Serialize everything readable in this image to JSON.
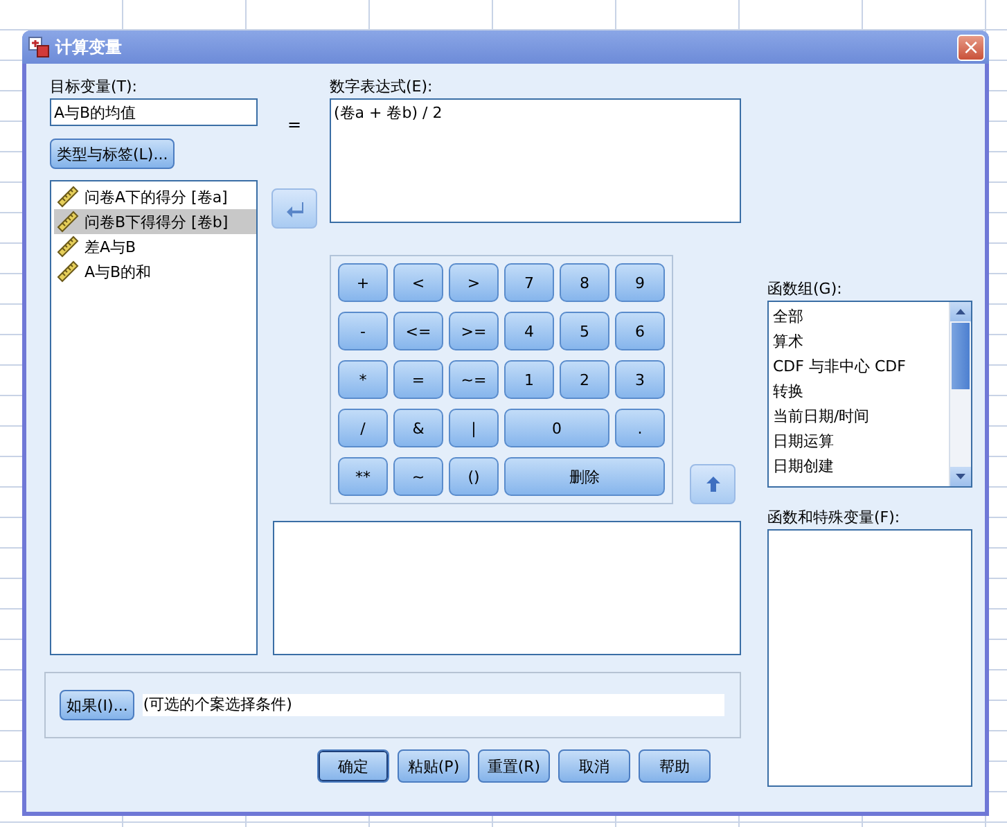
{
  "window": {
    "title": "计算变量",
    "close_label": "×"
  },
  "target": {
    "label": "目标变量(T):",
    "value": "A与B的均值",
    "type_button": "类型与标签(L)..."
  },
  "equals": "=",
  "variables": [
    {
      "name": "问卷A下的得分 [卷a]",
      "selected": false
    },
    {
      "name": "问卷B下得得分 [卷b]",
      "selected": true
    },
    {
      "name": "差A与B",
      "selected": false
    },
    {
      "name": "A与B的和",
      "selected": false
    }
  ],
  "expression": {
    "label": "数字表达式(E):",
    "value": "(卷a + 卷b) / 2"
  },
  "keypad": [
    {
      "label": "+",
      "kind": "key"
    },
    {
      "label": "<",
      "kind": "key"
    },
    {
      "label": ">",
      "kind": "key"
    },
    {
      "label": "7",
      "kind": "key"
    },
    {
      "label": "8",
      "kind": "key"
    },
    {
      "label": "9",
      "kind": "key"
    },
    {
      "label": "-",
      "kind": "key"
    },
    {
      "label": "<=",
      "kind": "key"
    },
    {
      "label": ">=",
      "kind": "key"
    },
    {
      "label": "4",
      "kind": "key"
    },
    {
      "label": "5",
      "kind": "key"
    },
    {
      "label": "6",
      "kind": "key"
    },
    {
      "label": "*",
      "kind": "key"
    },
    {
      "label": "=",
      "kind": "key"
    },
    {
      "label": "~=",
      "kind": "key"
    },
    {
      "label": "1",
      "kind": "key"
    },
    {
      "label": "2",
      "kind": "key"
    },
    {
      "label": "3",
      "kind": "key"
    },
    {
      "label": "/",
      "kind": "key"
    },
    {
      "label": "&",
      "kind": "key"
    },
    {
      "label": "|",
      "kind": "key"
    },
    {
      "label": "0",
      "kind": "double"
    },
    {
      "label": ".",
      "kind": "key"
    },
    {
      "label": "**",
      "kind": "key"
    },
    {
      "label": "~",
      "kind": "key"
    },
    {
      "label": "()",
      "kind": "key"
    },
    {
      "label": "删除",
      "kind": "triple"
    }
  ],
  "function_groups": {
    "label": "函数组(G):",
    "items": [
      {
        "name": "全部",
        "selected": false
      },
      {
        "name": "算术",
        "selected": false
      },
      {
        "name": "CDF 与非中心 CDF",
        "selected": false
      },
      {
        "name": "转换",
        "selected": false
      },
      {
        "name": "当前日期/时间",
        "selected": false
      },
      {
        "name": "日期运算",
        "selected": false
      },
      {
        "name": "日期创建",
        "selected": false
      }
    ]
  },
  "special_variables": {
    "label": "函数和特殊变量(F):"
  },
  "condition": {
    "button": "如果(I)...",
    "text": "(可选的个案选择条件)"
  },
  "buttons": [
    {
      "label": "确定",
      "default": true
    },
    {
      "label": "粘贴(P)",
      "default": false
    },
    {
      "label": "重置(R)",
      "default": false
    },
    {
      "label": "取消",
      "default": false
    },
    {
      "label": "帮助",
      "default": false
    }
  ]
}
